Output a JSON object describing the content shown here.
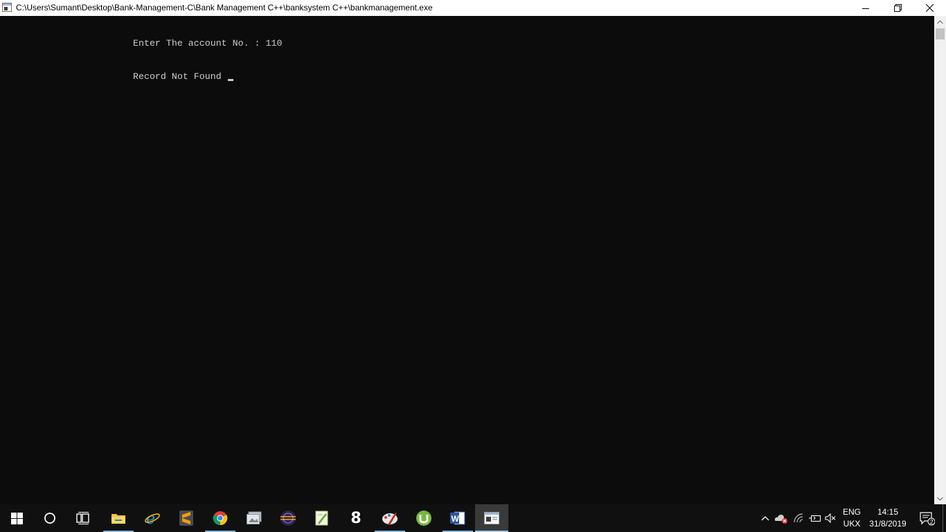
{
  "window": {
    "title": "C:\\Users\\Sumant\\Desktop\\Bank-Management-C\\Bank Management C++\\banksystem C++\\bankmanagement.exe"
  },
  "console": {
    "line1": "Enter The account No. : 110",
    "line2": "Record Not Found "
  },
  "taskbar": {
    "apps": [
      {
        "icon": "windows-start-icon"
      },
      {
        "icon": "cortana-search-icon"
      },
      {
        "icon": "task-view-icon"
      },
      {
        "icon": "file-explorer-icon"
      },
      {
        "icon": "internet-explorer-icon"
      },
      {
        "icon": "sublime-text-icon"
      },
      {
        "icon": "chrome-icon"
      },
      {
        "icon": "image-viewer-icon"
      },
      {
        "icon": "eclipse-icon"
      },
      {
        "icon": "notepad-plus-icon"
      },
      {
        "icon": "app-8-icon",
        "label": "8"
      },
      {
        "icon": "paint-tool-icon"
      },
      {
        "icon": "utorrent-icon"
      },
      {
        "icon": "word-icon",
        "label": "W"
      },
      {
        "icon": "console-app-icon"
      }
    ],
    "tray": {
      "language": "ENG",
      "layout": "UKX",
      "time": "14:15",
      "date": "31/8/2019",
      "notification_count": "2"
    }
  },
  "colors": {
    "console_bg": "#0c0c0c",
    "console_text": "#cccccc",
    "taskbar_bg": "#101010",
    "active_indicator": "#76b9ed"
  }
}
